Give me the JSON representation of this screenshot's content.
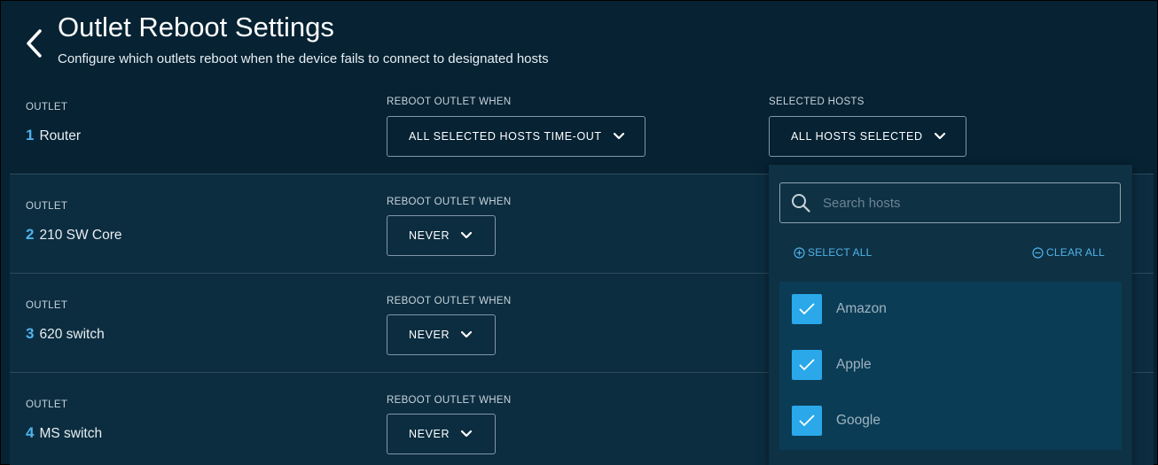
{
  "header": {
    "title": "Outlet Reboot Settings",
    "subtitle": "Configure which outlets reboot when the device fails to connect to designated hosts",
    "back_icon": "chevron-left-icon"
  },
  "columns": {
    "outlet": "OUTLET",
    "reboot_when": "REBOOT OUTLET WHEN",
    "selected_hosts": "SELECTED HOSTS"
  },
  "outlets": [
    {
      "number": "1",
      "name": "Router",
      "reboot_when": "ALL SELECTED HOSTS TIME-OUT",
      "selected_hosts": "ALL HOSTS SELECTED"
    },
    {
      "number": "2",
      "name": "210 SW Core",
      "reboot_when": "NEVER"
    },
    {
      "number": "3",
      "name": "620 switch",
      "reboot_when": "NEVER"
    },
    {
      "number": "4",
      "name": "MS switch",
      "reboot_when": "NEVER"
    }
  ],
  "hosts_popover": {
    "search_placeholder": "Search hosts",
    "select_all": "SELECT ALL",
    "clear_all": "CLEAR ALL",
    "hosts": [
      {
        "label": "Amazon",
        "checked": true
      },
      {
        "label": "Apple",
        "checked": true
      },
      {
        "label": "Google",
        "checked": true
      }
    ]
  },
  "colors": {
    "background": "#062233",
    "row_alt": "#0c2d40",
    "accent": "#4fb3ea",
    "checkbox": "#2aa8ea",
    "popover": "#0e3144"
  }
}
